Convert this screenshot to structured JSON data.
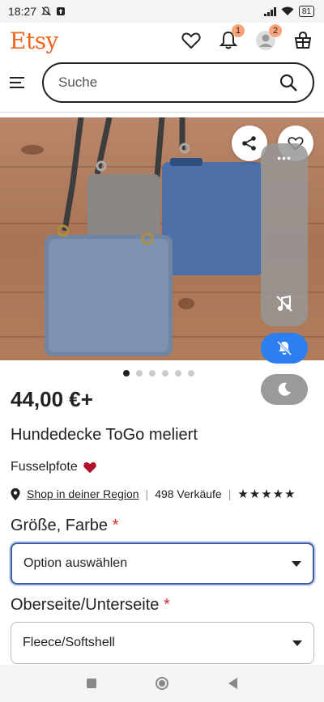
{
  "status_bar": {
    "time": "18:27",
    "battery": "81"
  },
  "header": {
    "logo": "Etsy",
    "notifications_badge": "1",
    "account_badge": "2"
  },
  "search": {
    "placeholder": "Suche"
  },
  "product": {
    "price": "44,00 €+",
    "title": "Hundedecke ToGo meliert",
    "shop_name": "Fusselpfote",
    "shop_region_link": "Shop in deiner Region",
    "sales": "498 Verkäufe",
    "rating_stars": "★★★★★",
    "image_count": 6,
    "active_image": 1
  },
  "options": [
    {
      "label": "Größe, Farbe",
      "required_mark": "*",
      "value": "Option auswählen"
    },
    {
      "label": "Oberseite/Unterseite",
      "required_mark": "*",
      "value": "Fleece/Softshell"
    }
  ],
  "colors": {
    "brand": "#f1641e",
    "required": "#d32f2f",
    "mute_button": "#2d7ff0",
    "heart": "#b3102c"
  }
}
